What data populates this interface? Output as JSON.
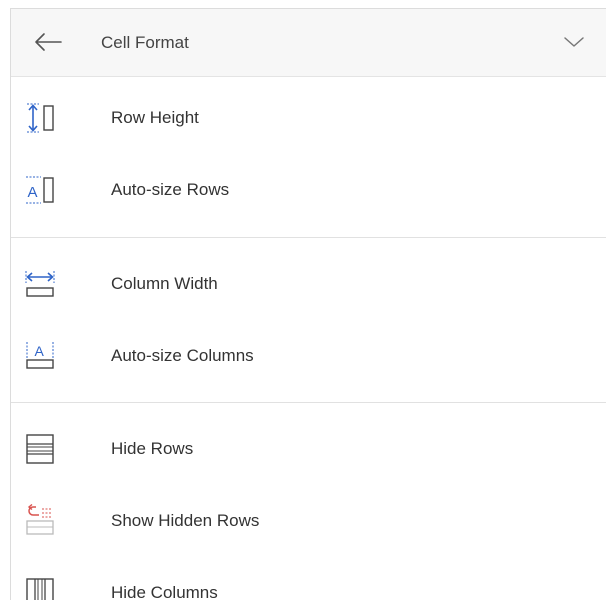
{
  "header": {
    "title": "Cell Format",
    "back_icon": "back-arrow-icon",
    "collapse_icon": "chevron-down-icon"
  },
  "colors": {
    "accent": "#2f64c8",
    "hidden_accent": "#d9534f",
    "icon_gray": "#444444"
  },
  "groups": [
    {
      "items": [
        {
          "label": "Row Height",
          "icon": "row-height-icon"
        },
        {
          "label": "Auto-size Rows",
          "icon": "auto-size-rows-icon"
        }
      ]
    },
    {
      "items": [
        {
          "label": "Column Width",
          "icon": "column-width-icon"
        },
        {
          "label": "Auto-size Columns",
          "icon": "auto-size-columns-icon"
        }
      ]
    },
    {
      "items": [
        {
          "label": "Hide Rows",
          "icon": "hide-rows-icon"
        },
        {
          "label": "Show Hidden Rows",
          "icon": "show-hidden-rows-icon"
        },
        {
          "label": "Hide Columns",
          "icon": "hide-columns-icon"
        }
      ]
    }
  ]
}
